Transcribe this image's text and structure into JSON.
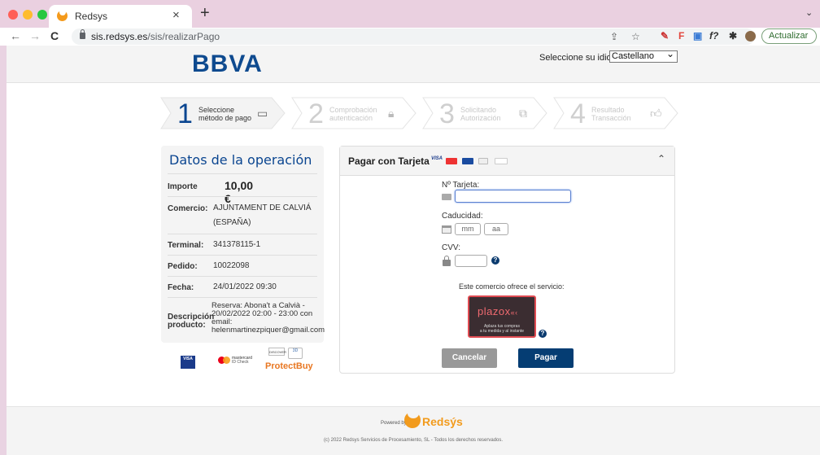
{
  "browser": {
    "tab_title": "Redsys",
    "url_host": "sis.redsys.es",
    "url_path": "/sis/realizarPago",
    "update_label": "Actualizar"
  },
  "header": {
    "logo": "BBVA",
    "lang_label": "Seleccione su idioma",
    "lang_value": "Castellano"
  },
  "steps": [
    {
      "num": "1",
      "line1": "Seleccione",
      "line2": "método de pago",
      "icon": "card-icon"
    },
    {
      "num": "2",
      "line1": "Comprobación",
      "line2": "autenticación",
      "icon": "lock-icon"
    },
    {
      "num": "3",
      "line1": "Solicitando",
      "line2": "Autorización",
      "icon": "transfer-icon"
    },
    {
      "num": "4",
      "line1": "Resultado",
      "line2": "Transacción",
      "icon": "thumbs-up-icon"
    }
  ],
  "datos": {
    "title": "Datos de la operación",
    "importe_label": "Importe",
    "importe_value": "10,00 €",
    "comercio_label": "Comercio:",
    "comercio_line1": "AJUNTAMENT DE CALVIÁ",
    "comercio_line2": "(ESPAÑA)",
    "terminal_label": "Terminal:",
    "terminal_value": "341378115-1",
    "pedido_label": "Pedido:",
    "pedido_value": "10022098",
    "fecha_label": "Fecha:",
    "fecha_value": "24/01/2022  09:30",
    "desc_label1": "Descripción",
    "desc_label2": "producto:",
    "desc_line1": "Reserva: Abona't a Calvià -",
    "desc_line2": "20/02/2022 02:00 - 23:00 con",
    "desc_line3": "email:",
    "desc_line4": "helenmartinezpiquer@gmail.com"
  },
  "secure_logos": {
    "visa": "VISA",
    "mastercard": "mastercard",
    "mastercard_sub": "ID Check",
    "protectbuy": "ProtectBuy"
  },
  "card": {
    "title": "Pagar con Tarjeta",
    "number_label": "Nº Tarjeta:",
    "expiry_label": "Caducidad:",
    "month_placeholder": "mm",
    "year_placeholder": "aa",
    "cvv_label": "CVV:",
    "service_text": "Este comercio ofrece el servicio:",
    "plazox_logo": "plazox",
    "plazox_sub1": "Aplaza tus compras",
    "plazox_sub2": "a tu medida y al instante",
    "cancel_label": "Cancelar",
    "pay_label": "Pagar"
  },
  "footer": {
    "powered": "Powered by",
    "brand": "Redsýs",
    "copyright": "(c) 2022 Redsys Servicios de Procesamiento, SL - Todos los derechos reservados."
  },
  "colors": {
    "brand_blue": "#0a4590",
    "pay_button": "#053d73",
    "cancel_button": "#999999",
    "redsys_orange": "#f29b1d",
    "plazox_red": "#e04b52"
  }
}
